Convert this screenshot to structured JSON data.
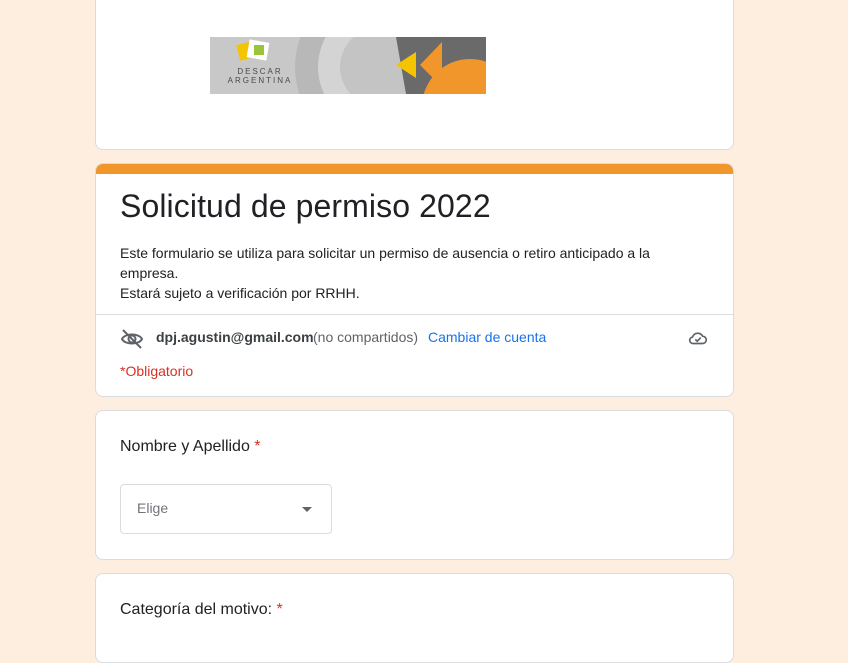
{
  "banner": {
    "logo_text_line1": "DESCAR",
    "logo_text_line2": "ARGENTINA",
    "colors": {
      "accent": "#f5c400",
      "accent2": "#f1962b",
      "dark": "#555555"
    }
  },
  "form": {
    "title": "Solicitud de permiso 2022",
    "description_line1": "Este formulario se utiliza para solicitar un permiso de ausencia o retiro anticipado a la empresa.",
    "description_line2": "Estará sujeto a verificación por RRHH.",
    "accent_color": "#f1962b"
  },
  "account": {
    "email": "dpj.agustin@gmail.com",
    "not_shared": "(no compartidos)",
    "change_label": "Cambiar de cuenta",
    "required_note": "*Obligatorio"
  },
  "questions": [
    {
      "label": "Nombre y Apellido",
      "required_mark": "*",
      "placeholder": "Elige"
    },
    {
      "label": "Categoría del motivo:",
      "required_mark": "*"
    }
  ],
  "icons": {
    "visibility_off": "eye-off-icon",
    "cloud": "cloud-saved-icon",
    "dropdown": "dropdown-arrow-icon"
  }
}
